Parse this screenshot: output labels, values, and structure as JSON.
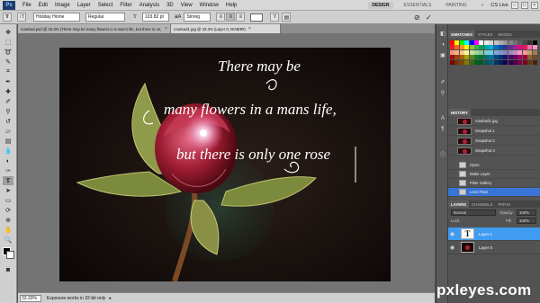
{
  "menubar": {
    "logo": "Ps",
    "items": [
      "File",
      "Edit",
      "Image",
      "Layer",
      "Select",
      "Filter",
      "Analysis",
      "3D",
      "View",
      "Window",
      "Help"
    ],
    "modes": [
      "DESIGN",
      "ESSENTIALS",
      "PAINTING"
    ],
    "active_mode": "DESIGN",
    "cslive": "CS Live",
    "window_controls": [
      "–",
      "□",
      "×"
    ]
  },
  "options": {
    "tool_icon": "T",
    "orient_icon": "↕T",
    "font_family": "Holiday Home",
    "font_style": "Regular",
    "font_size": "103.82 pt",
    "aa_label": "aA",
    "antialias": "Strong",
    "align_left": "≡",
    "align_center": "≡",
    "align_right": "≡",
    "warp_icon": "T",
    "panel_icon": "▤",
    "cancel_icon": "⊘",
    "commit_icon": "✓"
  },
  "doc_tabs": [
    {
      "label": "rosebud.psd @ 33.3% (There may be   many flowers in a man's life,   but there is on, RGB/8#)",
      "active": false
    },
    {
      "label": "rosebud1.jpg @ 33.3% (Layer 0, RGB/8#)",
      "active": true
    }
  ],
  "tab_close": "×",
  "artwork": {
    "line1": "There may be",
    "line2": "many flowers in a mans life,",
    "line3": "but there is only one rose"
  },
  "status": {
    "zoom": "33.33%",
    "text": "Exposure works in 32-bit only"
  },
  "panels": {
    "swatch_tabs": [
      "SWATCHES",
      "STYLES",
      "MASKS"
    ],
    "swatch_colors": [
      "#ff0000",
      "#ffff00",
      "#00ff00",
      "#00ffff",
      "#0000ff",
      "#ff00ff",
      "#ffffff",
      "#ebebeb",
      "#d6d6d6",
      "#c2c2c2",
      "#adadad",
      "#999999",
      "#858585",
      "#707070",
      "#5c5c5c",
      "#474747",
      "#333333",
      "#000000",
      "#ed1c24",
      "#f26522",
      "#f7941d",
      "#fff200",
      "#8dc63f",
      "#39b54a",
      "#00a651",
      "#00a99d",
      "#00aeef",
      "#0072bc",
      "#0054a6",
      "#2e3192",
      "#662d91",
      "#92278f",
      "#ec008c",
      "#ed145b",
      "#f06eaa",
      "#f49ac1",
      "#f7977a",
      "#f9ad81",
      "#fdc68a",
      "#fff79a",
      "#c4df9b",
      "#a3d39c",
      "#82ca9c",
      "#7accc8",
      "#6dcff6",
      "#7ea7d8",
      "#8493ca",
      "#8882be",
      "#a187be",
      "#bc8dbf",
      "#f49ac2",
      "#f6989d",
      "#c69c6d",
      "#a67c52",
      "#9e0b0f",
      "#a0410d",
      "#a3620a",
      "#aba000",
      "#598527",
      "#1a7b30",
      "#007236",
      "#00746b",
      "#0076a3",
      "#004a80",
      "#003471",
      "#1b1464",
      "#440e62",
      "#630460",
      "#9e005d",
      "#9e0039",
      "#8c6239",
      "#754c24",
      "#790000",
      "#7b2e00",
      "#7d4900",
      "#827b00",
      "#406618",
      "#005e20",
      "#005826",
      "#005952",
      "#005b7f",
      "#003663",
      "#002157",
      "#0d004c",
      "#32004b",
      "#4b0049",
      "#7b0046",
      "#7a0026",
      "#603913",
      "#42210b"
    ],
    "history_tab": "HISTORY",
    "history_source": "rosebud1.jpg",
    "history_snapshots": [
      "Snapshot 1",
      "Snapshot 2",
      "Snapshot 3"
    ],
    "history_states": [
      "Open",
      "Make Layer",
      "Filter Gallery",
      "Lens Flare"
    ],
    "layers_tabs": [
      "LAYERS",
      "CHANNELS",
      "PATHS"
    ],
    "blend_mode": "Normal",
    "opacity_label": "Opacity:",
    "opacity_value": "100%",
    "lock_label": "Lock:",
    "fill_label": "Fill:",
    "fill_value": "100%",
    "layers": [
      {
        "name": "Layer 1",
        "thumb": "T",
        "active": true
      },
      {
        "name": "Layer 0",
        "thumb": "",
        "active": false
      }
    ],
    "eye_icon": "👁"
  },
  "watermark": "pxleyes.com",
  "accent": "#3f9cf0"
}
